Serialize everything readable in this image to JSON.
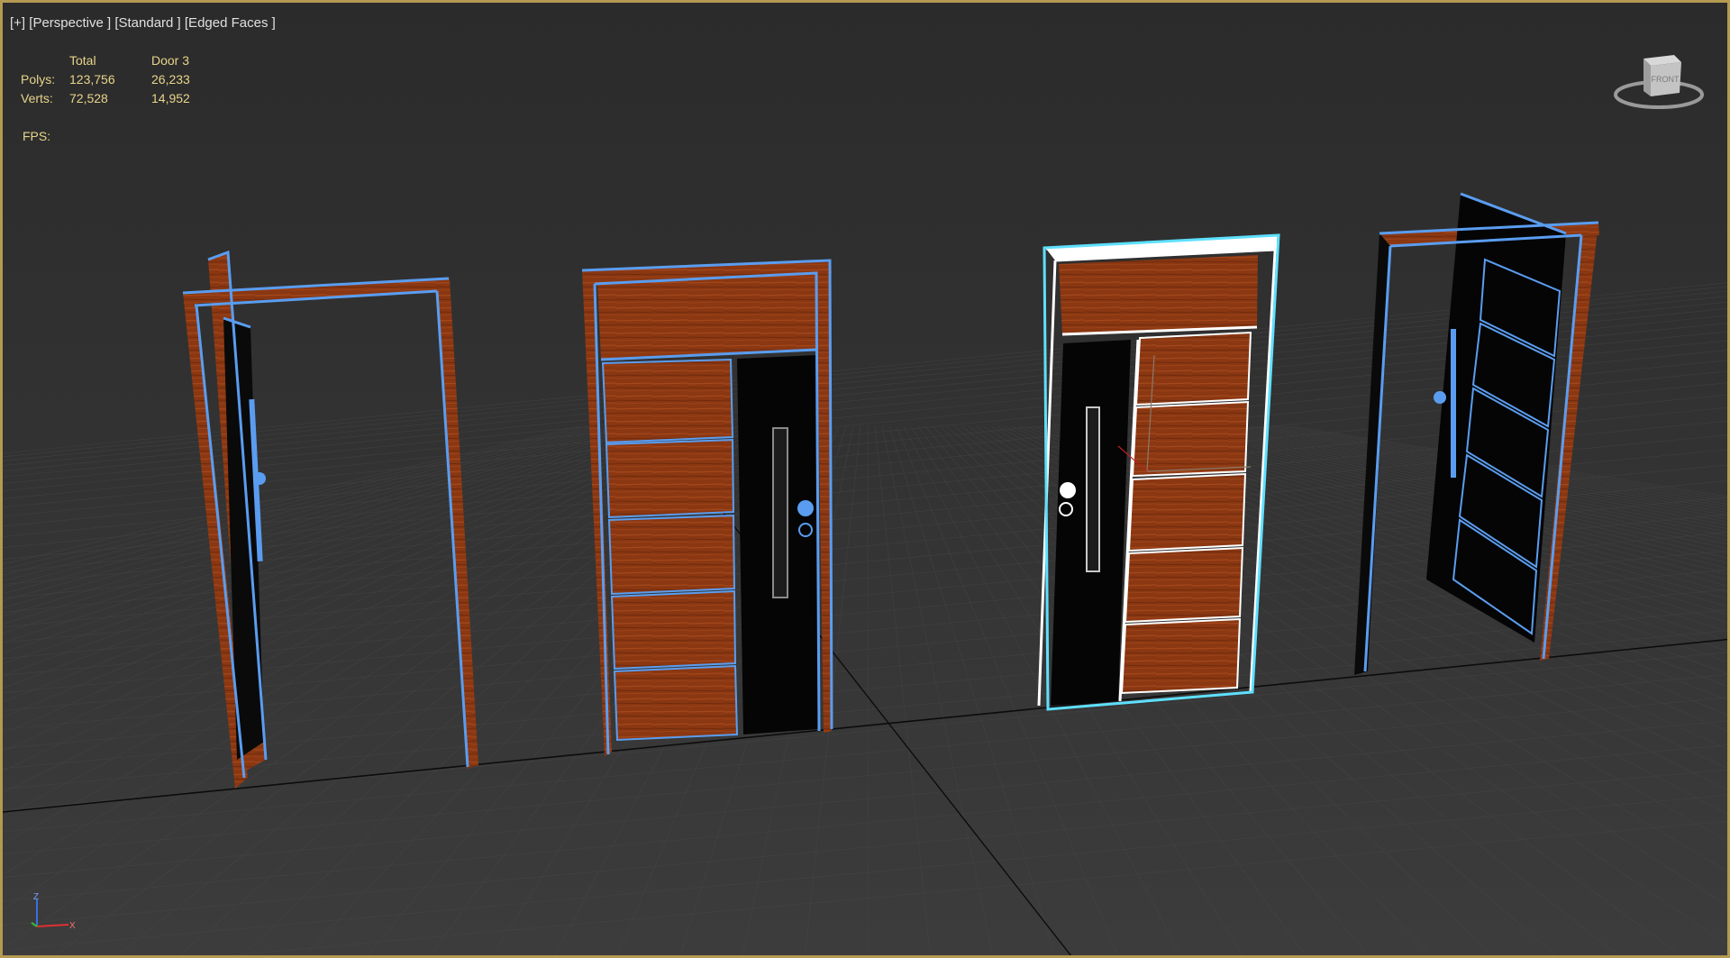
{
  "viewport": {
    "label_plus": "[+]",
    "label_view": "[Perspective ]",
    "label_shading": "[Standard ]",
    "label_edges": "[Edged Faces ]"
  },
  "stats": {
    "header_total": "Total",
    "header_selected": "Door 3",
    "polys_label": "Polys:",
    "polys_total": "123,756",
    "polys_selected": "26,233",
    "verts_label": "Verts:",
    "verts_total": "72,528",
    "verts_selected": "14,952",
    "fps_label": "FPS:"
  },
  "viewcube": {
    "face_label": "FRONT"
  },
  "axis_gizmo": {
    "z": "Z",
    "x": "X"
  },
  "colors": {
    "frame_border": "#b59a52",
    "stats_text": "#e8d48a",
    "wireframe_blue": "#5a9df0",
    "selection_cyan": "#5ee0ff",
    "wood": "#8a3712",
    "panel_dark": "#050505"
  }
}
